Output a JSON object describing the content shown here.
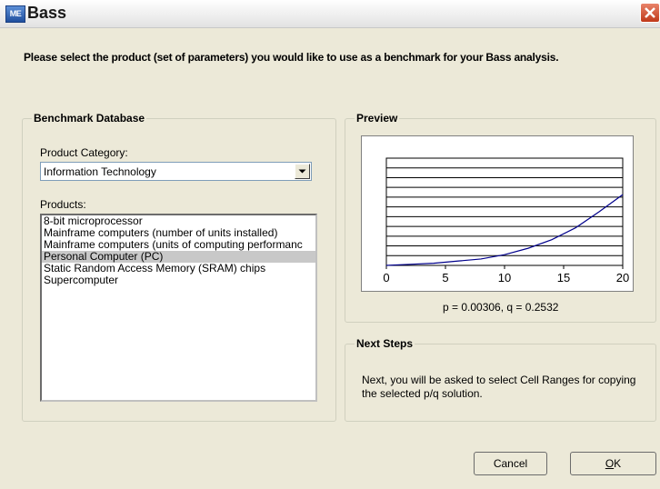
{
  "window": {
    "title": "Bass",
    "app_icon_text": "ME"
  },
  "instruction": "Please select the product (set of parameters) you would like to use as a benchmark for your Bass analysis.",
  "benchmark": {
    "legend": "Benchmark Database",
    "category_label": "Product Category:",
    "category_value": "Information Technology",
    "products_label": "Products:",
    "products": [
      "8-bit microprocessor",
      "Mainframe computers (number of units installed)",
      "Mainframe computers (units of computing performanc",
      "Personal Computer (PC)",
      "Static Random Access Memory (SRAM) chips",
      "Supercomputer"
    ],
    "selected_index": 3
  },
  "preview": {
    "legend": "Preview",
    "pq_text": "p = 0.00306, q = 0.2532"
  },
  "chart_data": {
    "type": "line",
    "x_ticks": [
      "0",
      "5",
      "10",
      "15",
      "20"
    ],
    "xlim": [
      0,
      20
    ],
    "ylim": [
      0,
      1
    ],
    "grid": true,
    "series": [
      {
        "color": "#00008b",
        "x": [
          0,
          2,
          4,
          6,
          8,
          10,
          12,
          14,
          16,
          18,
          20
        ],
        "y": [
          0.0,
          0.01,
          0.02,
          0.04,
          0.06,
          0.1,
          0.16,
          0.24,
          0.35,
          0.5,
          0.66
        ]
      }
    ]
  },
  "next_steps": {
    "legend": "Next Steps",
    "text": "Next, you will be asked to select Cell Ranges for copying the selected p/q solution."
  },
  "buttons": {
    "cancel": "Cancel",
    "ok_underlined": "O",
    "ok_rest": "K"
  }
}
